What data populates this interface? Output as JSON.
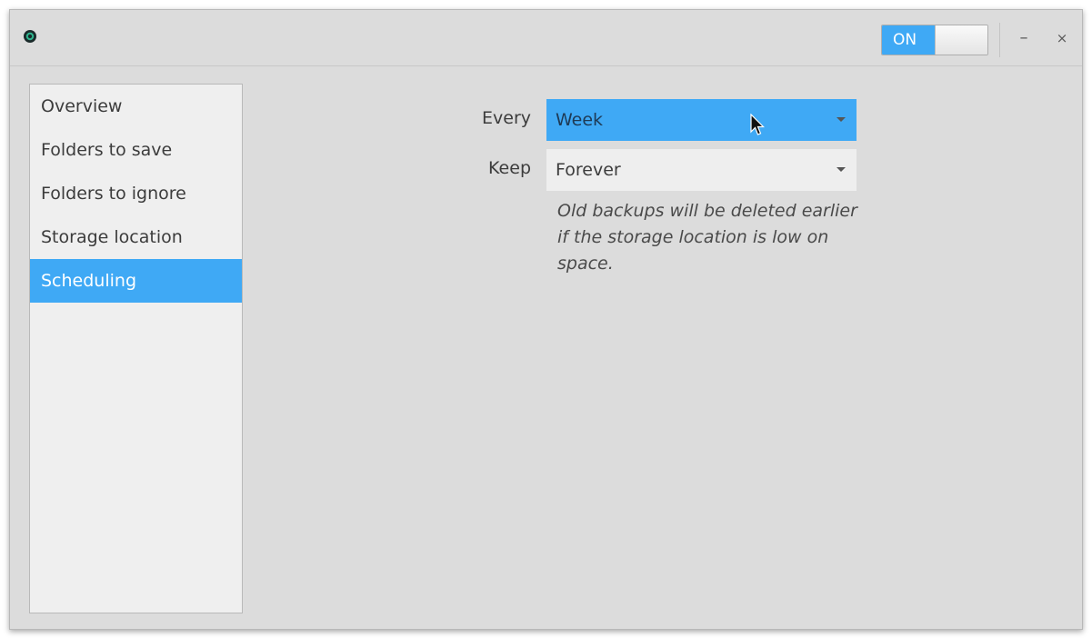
{
  "toggle": {
    "label": "ON",
    "state": "on"
  },
  "window_controls": {
    "minimize": "–",
    "close": "×"
  },
  "sidebar": {
    "items": [
      {
        "label": "Overview",
        "active": false
      },
      {
        "label": "Folders to save",
        "active": false
      },
      {
        "label": "Folders to ignore",
        "active": false
      },
      {
        "label": "Storage location",
        "active": false
      },
      {
        "label": "Scheduling",
        "active": true
      }
    ]
  },
  "scheduling": {
    "every_label": "Every",
    "every_value": "Week",
    "keep_label": "Keep",
    "keep_value": "Forever",
    "hint": "Old backups will be deleted earlier if the storage location is low on space."
  },
  "colors": {
    "accent": "#3fa9f5",
    "window_bg": "#dcdcdc",
    "sidebar_bg": "#efefef"
  }
}
